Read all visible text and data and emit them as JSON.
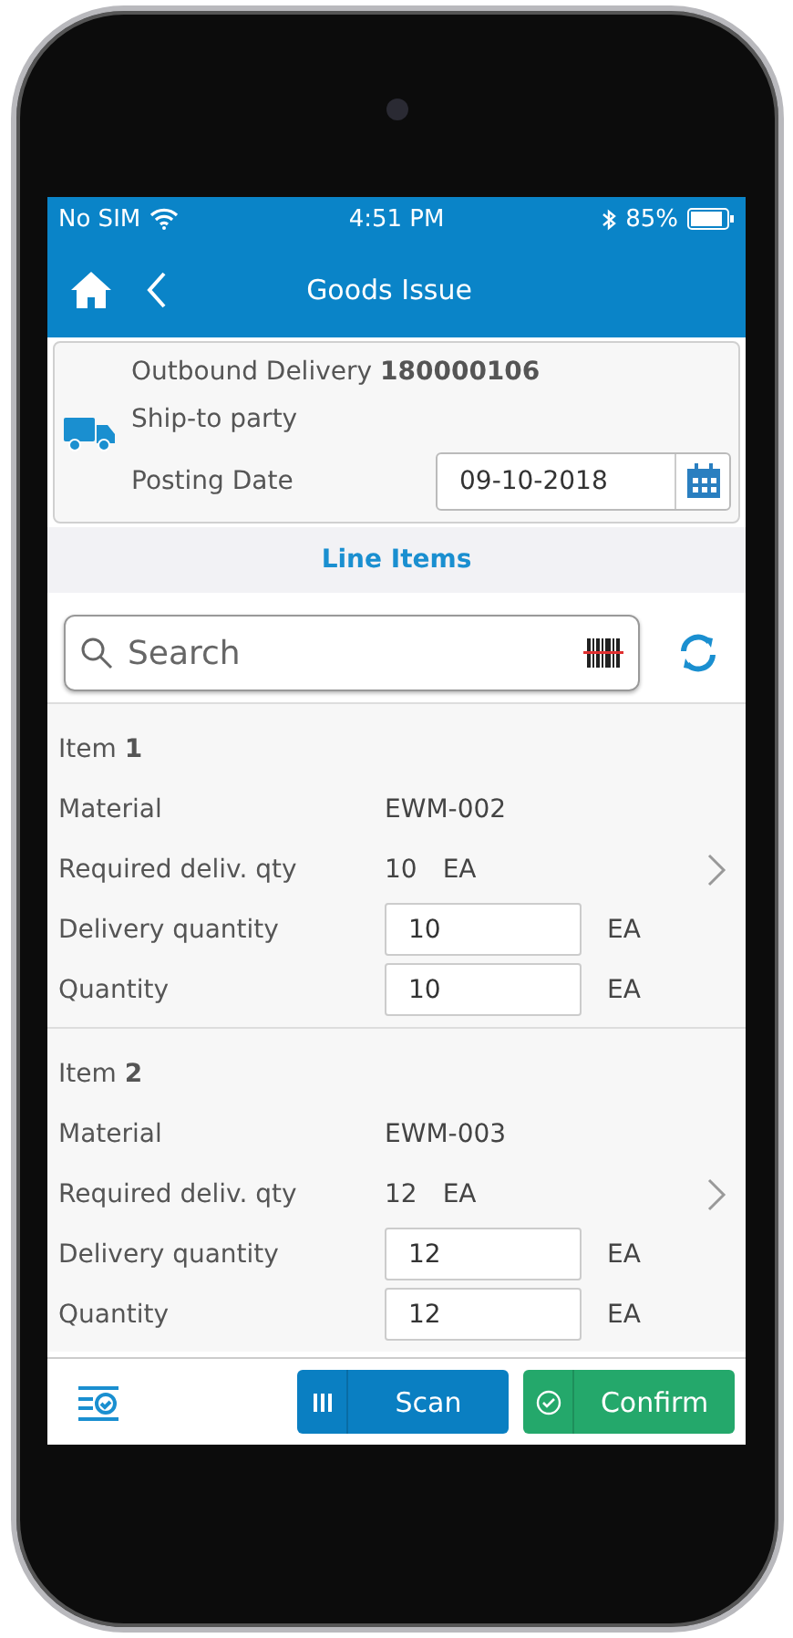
{
  "status_bar": {
    "carrier": "No SIM",
    "time": "4:51 PM",
    "battery": "85%"
  },
  "nav": {
    "title": "Goods Issue"
  },
  "header": {
    "delivery": "Outbound Delivery **180000106**",
    "ship_to": "Ship-to party",
    "posting_label": "Posting Date",
    "posting_date": "09-10-2018"
  },
  "section_title": "Line Items",
  "search": {
    "placeholder": "Search"
  },
  "items": [
    {
      "title": "Item **1**",
      "fields": [
        {
          "kind": "text",
          "label": "Material",
          "value": "EWM-002"
        },
        {
          "kind": "text",
          "label": "Required deliv. qty",
          "value": "10",
          "unit": "EA"
        },
        {
          "kind": "input",
          "label": "Delivery quantity",
          "value": "10",
          "unit": "EA"
        },
        {
          "kind": "input",
          "label": "Quantity",
          "value": "10",
          "unit": "EA"
        }
      ]
    },
    {
      "title": "Item **2**",
      "fields": [
        {
          "kind": "text",
          "label": "Material",
          "value": "EWM-003"
        },
        {
          "kind": "text",
          "label": "Required deliv. qty",
          "value": "12",
          "unit": "EA"
        },
        {
          "kind": "input",
          "label": "Delivery quantity",
          "value": "12",
          "unit": "EA"
        },
        {
          "kind": "input",
          "label": "Quantity",
          "value": "12",
          "unit": "EA"
        }
      ]
    }
  ],
  "buttons": [
    {
      "kind": "scan",
      "label": "Scan"
    },
    {
      "kind": "confirm",
      "label": "Confirm"
    }
  ]
}
